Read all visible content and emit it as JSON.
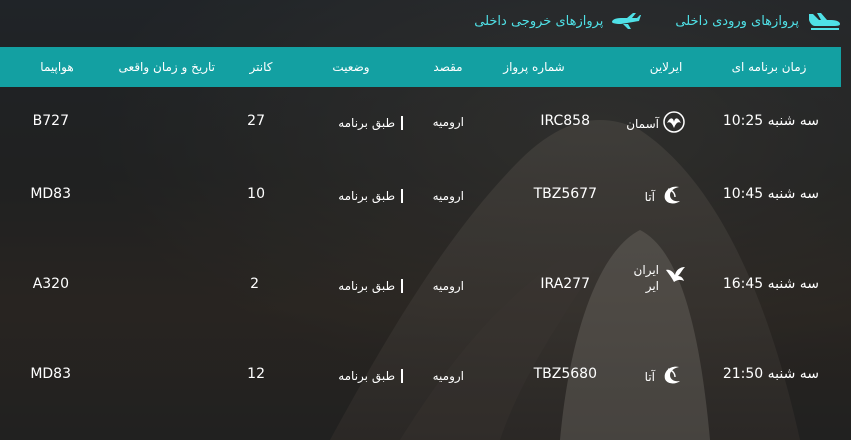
{
  "tabs": [
    {
      "label": "پروازهای ورودی داخلی",
      "icon": "plane-landing-icon"
    },
    {
      "label": "پروازهای خروجی داخلی",
      "icon": "plane-takeoff-icon"
    }
  ],
  "table": {
    "headers": {
      "scheduled_time": "زمان برنامه ای",
      "airline": "ایرلاین",
      "flight_number": "شماره پرواز",
      "destination": "مقصد",
      "status": "وضعیت",
      "counter": "کانتر",
      "actual_time": "تاریخ و زمان واقعی",
      "aircraft": "هواپیما"
    },
    "rows": [
      {
        "time": "سه شنبه 10:25",
        "airline": "آسمان",
        "airline_logo": "aseman-logo-icon",
        "flight": "IRC858",
        "destination": "ارومیه",
        "status": "طبق برنامه",
        "counter": "27",
        "aircraft": "B727"
      },
      {
        "time": "سه شنبه 10:45",
        "airline": "آتا",
        "airline_logo": "ata-logo-icon",
        "flight": "TBZ5677",
        "destination": "ارومیه",
        "status": "طبق برنامه",
        "counter": "10",
        "aircraft": "MD83"
      },
      {
        "time": "سه شنبه 16:45",
        "airline": "ایران ایر",
        "airline_logo": "iranair-logo-icon",
        "flight": "IRA277",
        "destination": "ارومیه",
        "status": "طبق برنامه",
        "counter": "2",
        "aircraft": "A320"
      },
      {
        "time": "سه شنبه 21:50",
        "airline": "آتا",
        "airline_logo": "ata-logo-icon",
        "flight": "TBZ5680",
        "destination": "ارومیه",
        "status": "طبق برنامه",
        "counter": "12",
        "aircraft": "MD83"
      }
    ]
  },
  "colors": {
    "accent": "#13a0a2",
    "tab_text": "#4fe0e6"
  }
}
